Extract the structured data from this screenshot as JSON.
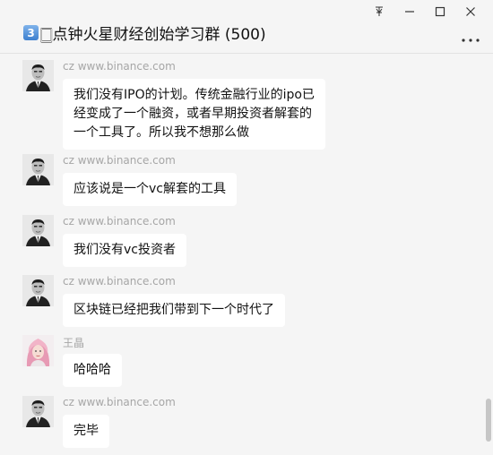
{
  "window": {
    "pin_icon": "pin-icon",
    "minimize_icon": "minimize-icon",
    "maximize_icon": "maximize-icon",
    "close_icon": "close-icon"
  },
  "header": {
    "badge": "3",
    "title": "🀆点钟火星财经创始学习群 (500)",
    "more_icon": "more-icon"
  },
  "messages": [
    {
      "sender": "cz www.binance.com",
      "lines": [
        "我们没有IPO的计划。传统金融行业的ipo已",
        "经变成了一个融资，或者早期投资者解套的",
        "一个工具了。所以我不想那么做"
      ]
    },
    {
      "sender": "cz www.binance.com",
      "lines": [
        "应该说是一个vc解套的工具"
      ]
    },
    {
      "sender": "cz www.binance.com",
      "lines": [
        "我们没有vc投资者"
      ]
    },
    {
      "sender": "cz www.binance.com",
      "lines": [
        "区块链已经把我们带到下一个时代了"
      ]
    },
    {
      "sender": "王晶",
      "lines": [
        "哈哈哈"
      ]
    },
    {
      "sender": "cz www.binance.com",
      "lines": [
        "完毕"
      ]
    }
  ],
  "colors": {
    "background": "#f5f5f5",
    "bubble": "#ffffff",
    "sender_text": "#a6a6a6"
  }
}
